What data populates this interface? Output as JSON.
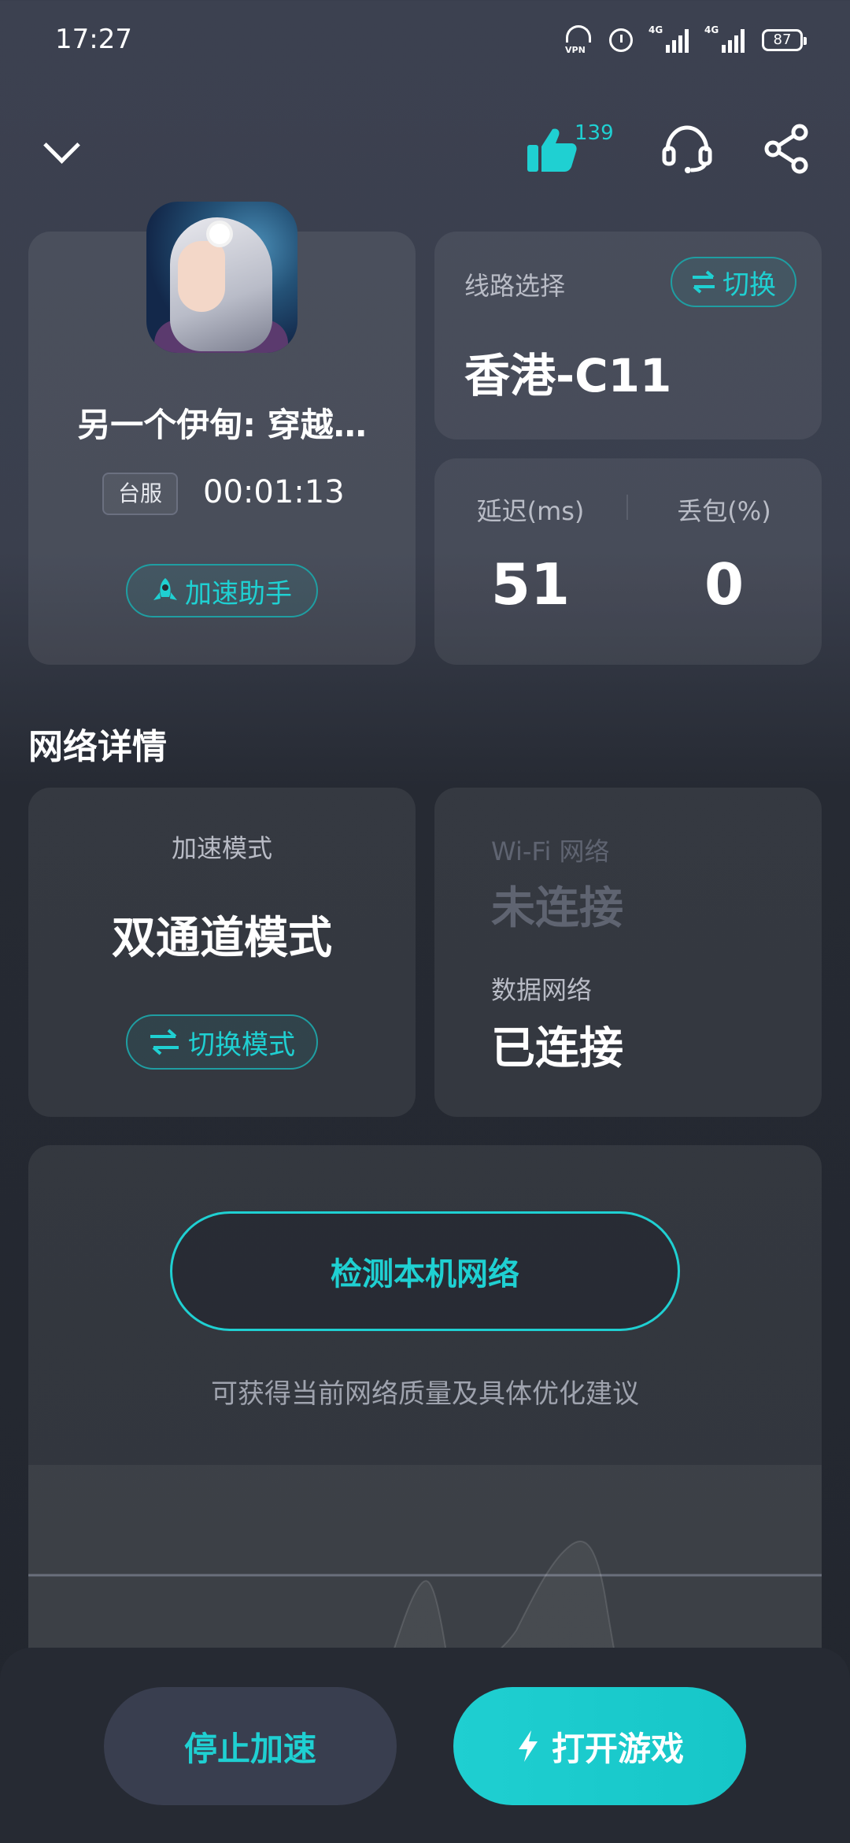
{
  "status_bar": {
    "time": "17:27",
    "vpn_label": "VPN",
    "net1": "4G",
    "net2": "4G",
    "battery": "87"
  },
  "header": {
    "back_icon": "chevron-down-icon",
    "like_icon": "thumbs-up-icon",
    "like_count": "139",
    "support_icon": "headset-icon",
    "share_icon": "share-icon"
  },
  "game": {
    "title": "另一个伊甸: 穿越…",
    "region": "台服",
    "elapsed": "00:01:13",
    "assist_label": "加速助手"
  },
  "route": {
    "label": "线路选择",
    "switch_label": "切换",
    "value": "香港-C11"
  },
  "stats": {
    "latency_label": "延迟(ms)",
    "latency_value": "51",
    "loss_label": "丢包(%)",
    "loss_value": "0"
  },
  "network": {
    "section_title": "网络详情",
    "mode_label": "加速模式",
    "mode_value": "双通道模式",
    "mode_switch_label": "切换模式",
    "wifi_label": "Wi-Fi 网络",
    "wifi_value": "未连接",
    "data_label": "数据网络",
    "data_value": "已连接"
  },
  "detect": {
    "button_label": "检测本机网络",
    "hint": "可获得当前网络质量及具体优化建议"
  },
  "actions": {
    "stop_label": "停止加速",
    "open_label": "打开游戏"
  },
  "colors": {
    "accent": "#1fd0d2",
    "background": "#3a3f4d",
    "card": "#474c59"
  }
}
